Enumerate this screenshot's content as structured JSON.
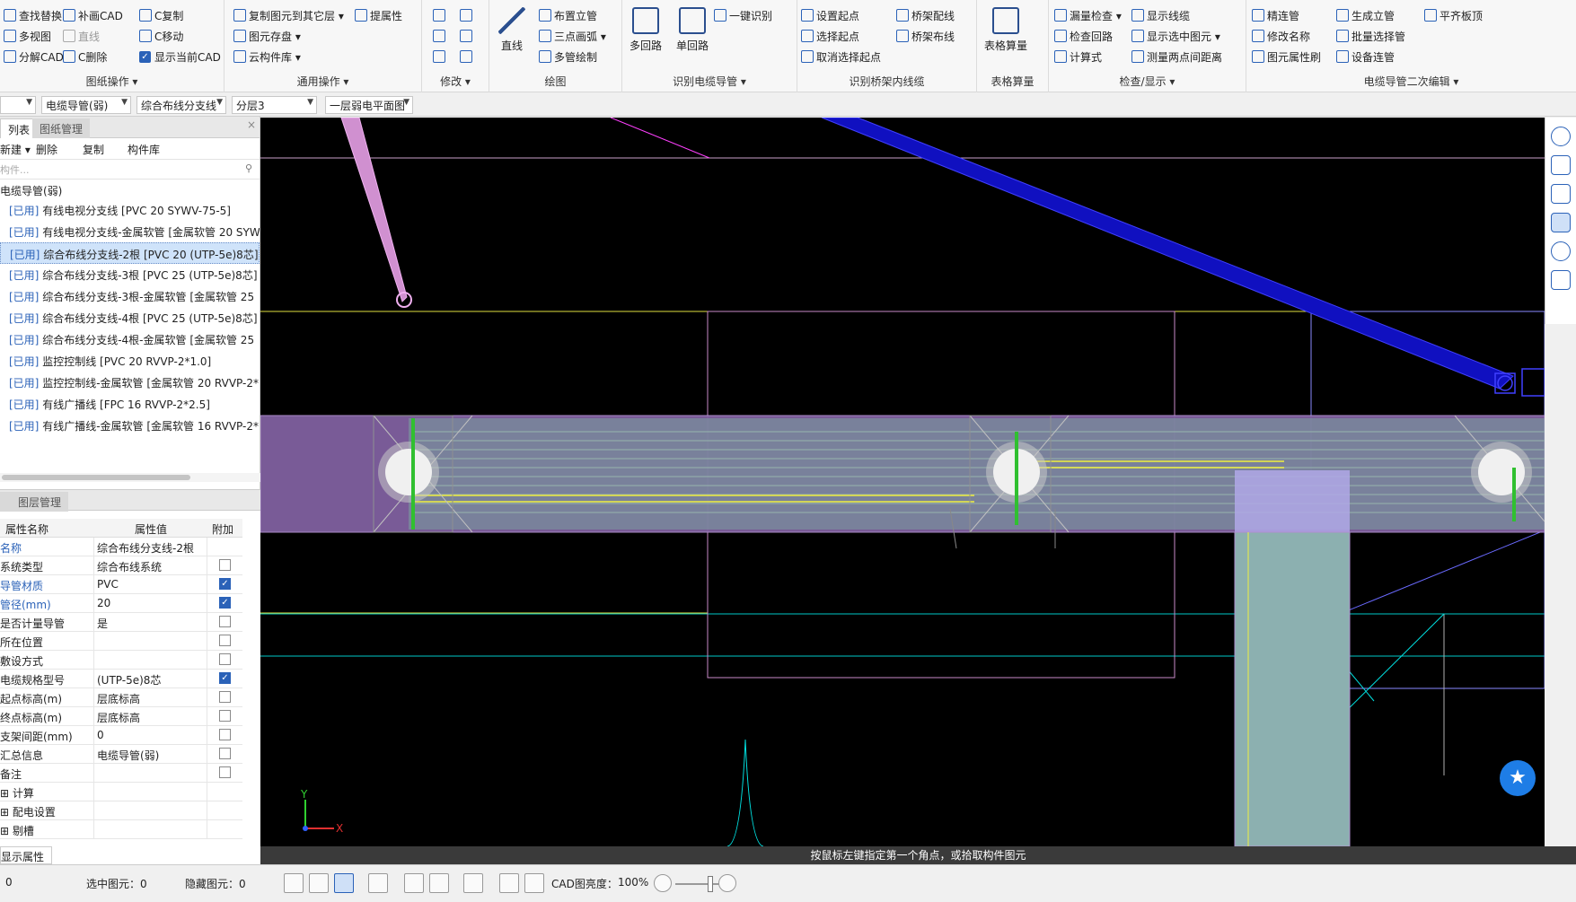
{
  "ribbon": {
    "g1": {
      "label": "图纸操作 ▾",
      "items": [
        "查找替换",
        "多视图",
        "分解CAD",
        "补画CAD",
        "直线",
        "C删除",
        "C复制",
        "C移动",
        "显示当前CAD"
      ]
    },
    "g2": {
      "label": "通用操作 ▾",
      "items": [
        "复制图元到其它层 ▾",
        "提属性",
        "图元存盘 ▾",
        "云构件库 ▾"
      ]
    },
    "g3": {
      "label": "修改 ▾"
    },
    "g4": {
      "label": "绘图",
      "items": [
        "直线",
        "布置立管",
        "三点画弧 ▾",
        "多管绘制"
      ]
    },
    "g5": {
      "label": "识别电缆导管 ▾",
      "items": [
        "多回路",
        "单回路",
        "一键识别"
      ]
    },
    "g6": {
      "label": "识别桥架内线缆",
      "items": [
        "设置起点",
        "选择起点",
        "取消选择起点",
        "桥架配线",
        "桥架布线"
      ]
    },
    "g7": {
      "label": "表格算量",
      "items": [
        "表格算量"
      ]
    },
    "g8": {
      "label": "检查/显示 ▾",
      "items": [
        "漏量检查 ▾",
        "检查回路",
        "计算式",
        "显示线缆",
        "显示选中图元 ▾",
        "测量两点间距离"
      ]
    },
    "g9": {
      "label": "电缆导管二次编辑 ▾",
      "items": [
        "精连管",
        "修改名称",
        "图元属性刷",
        "生成立管",
        "批量选择管",
        "设备连管",
        "平齐板顶"
      ]
    }
  },
  "combos": [
    "",
    "电缆导管(弱)",
    "综合布线分支线",
    "分层3",
    "一层弱电平面图"
  ],
  "left": {
    "tabs": [
      "列表",
      "图纸管理"
    ],
    "tools": [
      "新建 ▾",
      "删除",
      "复制",
      "构件库"
    ],
    "search_placeholder": "构件...",
    "root": "电缆导管(弱)",
    "items": [
      {
        "tag": "[已用]",
        "text": "有线电视分支线 [PVC 20 SYWV-75-5]"
      },
      {
        "tag": "[已用]",
        "text": "有线电视分支线-金属软管 [金属软管 20 SYW"
      },
      {
        "tag": "[已用]",
        "text": "综合布线分支线-2根 [PVC 20 (UTP-5e)8芯]"
      },
      {
        "tag": "[已用]",
        "text": "综合布线分支线-3根 [PVC 25 (UTP-5e)8芯]"
      },
      {
        "tag": "[已用]",
        "text": "综合布线分支线-3根-金属软管 [金属软管 25"
      },
      {
        "tag": "[已用]",
        "text": "综合布线分支线-4根 [PVC 25 (UTP-5e)8芯]"
      },
      {
        "tag": "[已用]",
        "text": "综合布线分支线-4根-金属软管 [金属软管 25"
      },
      {
        "tag": "[已用]",
        "text": "监控控制线 [PVC 20 RVVP-2*1.0]"
      },
      {
        "tag": "[已用]",
        "text": "监控控制线-金属软管 [金属软管 20 RVVP-2*"
      },
      {
        "tag": "[已用]",
        "text": "有线广播线 [FPC 16 RVVP-2*2.5]"
      },
      {
        "tag": "[已用]",
        "text": "有线广播线-金属软管 [金属软管 16 RVVP-2*"
      }
    ]
  },
  "props": {
    "tabs": [
      "属性",
      "图层管理"
    ],
    "headers": [
      "属性名称",
      "属性值",
      "附加"
    ],
    "rows": [
      {
        "name": "名称",
        "value": "综合布线分支线-2根",
        "check": null,
        "blue": true
      },
      {
        "name": "系统类型",
        "value": "综合布线系统",
        "check": false,
        "blue": false
      },
      {
        "name": "导管材质",
        "value": "PVC",
        "check": true,
        "blue": true
      },
      {
        "name": "管径(mm)",
        "value": "20",
        "check": true,
        "blue": true
      },
      {
        "name": "是否计量导管",
        "value": "是",
        "check": false,
        "blue": false
      },
      {
        "name": "所在位置",
        "value": "",
        "check": false,
        "blue": false
      },
      {
        "name": "敷设方式",
        "value": "",
        "check": false,
        "blue": false
      },
      {
        "name": "电缆规格型号",
        "value": "(UTP-5e)8芯",
        "check": true,
        "blue": false
      },
      {
        "name": "起点标高(m)",
        "value": "层底标高",
        "check": false,
        "blue": false
      },
      {
        "name": "终点标高(m)",
        "value": "层底标高",
        "check": false,
        "blue": false
      },
      {
        "name": "支架间距(mm)",
        "value": "0",
        "check": false,
        "blue": false
      },
      {
        "name": "汇总信息",
        "value": "电缆导管(弱)",
        "check": false,
        "blue": false
      },
      {
        "name": "备注",
        "value": "",
        "check": false,
        "blue": false
      },
      {
        "name": "⊞ 计算",
        "value": "",
        "check": null,
        "blue": false
      },
      {
        "name": "⊞ 配电设置",
        "value": "",
        "check": null,
        "blue": false
      },
      {
        "name": "⊞ 剔槽",
        "value": "",
        "check": null,
        "blue": false
      }
    ],
    "bottom_tab": "显示属性"
  },
  "status": {
    "message": "按鼠标左键指定第一个角点，或拾取构件图元",
    "count": "0",
    "selected_label": "选中图元：0",
    "hidden_label": "隐藏图元：0",
    "cad_brightness_label": "CAD图亮度：",
    "cad_brightness_value": "100%"
  },
  "axes": {
    "x": "X",
    "y": "Y"
  }
}
